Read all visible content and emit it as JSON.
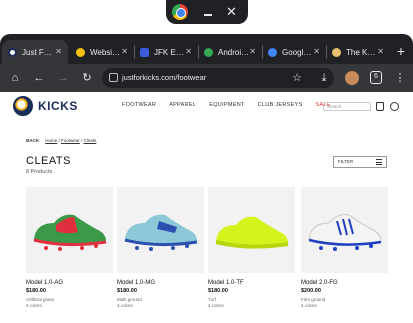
{
  "window": {
    "icon": "chrome-icon"
  },
  "tabs": [
    {
      "title": "Just F…",
      "favicon": "#ffffff",
      "active": true
    },
    {
      "title": "Websi…",
      "favicon": "#f4c20d",
      "active": false
    },
    {
      "title": "JFK E…",
      "favicon": "#3b5bdb",
      "active": false
    },
    {
      "title": "Androi…",
      "favicon": "#34a853",
      "active": false
    },
    {
      "title": "Googl…",
      "favicon": "#4285f4",
      "active": false
    },
    {
      "title": "The K…",
      "favicon": "#e8c070",
      "active": false
    }
  ],
  "toolbar": {
    "url": "justforkicks.com/footwear",
    "tabs_count": "6"
  },
  "site": {
    "brand": "KICKS",
    "nav": [
      "FOOTWEAR",
      "APPAREL",
      "EQUIPMENT",
      "CLUB JERSEYS",
      "SALE"
    ],
    "search_placeholder": "Search"
  },
  "breadcrumb": {
    "back": "BACK",
    "items": [
      "Home",
      "Footwear",
      "Cleats"
    ]
  },
  "page": {
    "title": "CLEATS",
    "count": "8 Products",
    "filter_label": "FILTER"
  },
  "products": [
    {
      "name": "Model 1.0-AG",
      "price": "$180.00",
      "surface": "Artificial grass",
      "colors": "4 colors",
      "color": "#3a9a4a",
      "accent": "#e0303f"
    },
    {
      "name": "Model 1.0-MG",
      "price": "$180.00",
      "surface": "Multi ground",
      "colors": "3 colors",
      "color": "#8cc8d8",
      "accent": "#2a4fb0"
    },
    {
      "name": "Model 1.0-TF",
      "price": "$180.00",
      "surface": "Turf",
      "colors": "4 colors",
      "color": "#d4f21b",
      "accent": "#b8d610"
    },
    {
      "name": "Model 2.0-FG",
      "price": "$200.00",
      "surface": "Firm ground",
      "colors": "4 colors",
      "color": "#f4f4f4",
      "accent": "#1f3fbf"
    }
  ]
}
